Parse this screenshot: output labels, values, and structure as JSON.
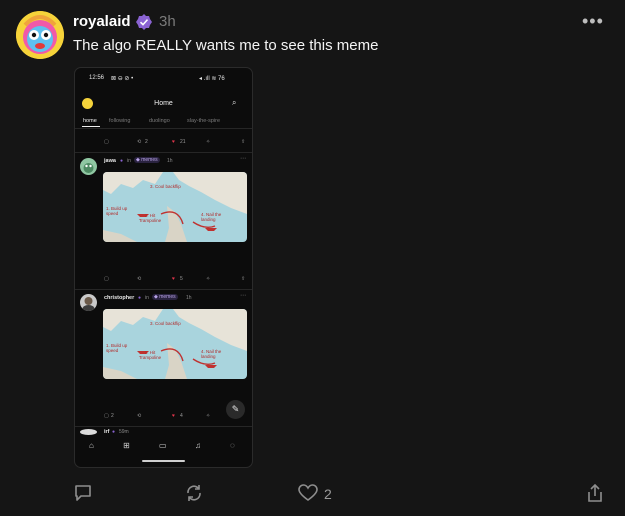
{
  "post": {
    "author": "royalaid",
    "time": "3h",
    "text": "The algo REALLY wants me to see this meme",
    "more": "•••",
    "like_count": "2"
  },
  "phone": {
    "status_time": "12:56",
    "status_icons_left": "⊠ ⊖ ⊘ •",
    "status_icons_right": "◂ .ıll ≋ 76",
    "title": "Home",
    "tabs": [
      "home",
      "following",
      "duolingo",
      "slay-the-spire"
    ],
    "top_actions": {
      "recasts": "2",
      "likes": "21"
    },
    "posts": [
      {
        "user": "jawa",
        "in": "in",
        "channel": "memes",
        "time": "1h",
        "likes": "5"
      },
      {
        "user": "christopher",
        "in": "in",
        "channel": "memes",
        "time": "1h",
        "likes": "4",
        "replies": "2"
      },
      {
        "user": "irf",
        "time": "59m"
      }
    ],
    "map_labels": {
      "step1": "1. Build up speed",
      "step2": "2. Hit Trampoline",
      "step3": "3. Cool backflip",
      "step4": "4. Nail the landing"
    }
  },
  "colors": {
    "accent": "#8a63d2",
    "like": "#e0344b",
    "background": "#151515"
  },
  "icons": [
    "verified-icon",
    "more-icon",
    "comment-icon",
    "recast-icon",
    "heart-icon",
    "share-icon"
  ]
}
